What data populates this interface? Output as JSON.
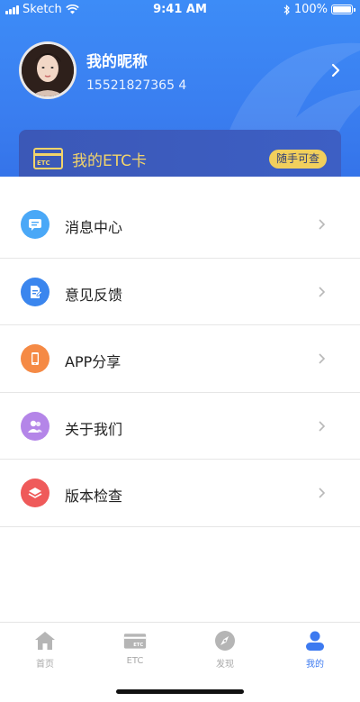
{
  "status_bar": {
    "carrier": "Sketch",
    "time": "9:41 AM",
    "battery": "100%",
    "battery_level": 1.0
  },
  "profile": {
    "nickname": "我的昵称",
    "phone": "15521827365 4"
  },
  "etc_card": {
    "icon_text": "ETC",
    "title": "我的ETC卡",
    "button_label": "随手可查"
  },
  "menu": [
    {
      "label": "消息中心",
      "icon": "message-icon",
      "color": "#4aa8f7"
    },
    {
      "label": "意见反馈",
      "icon": "feedback-icon",
      "color": "#3b86ee"
    },
    {
      "label": "APP分享",
      "icon": "phone-share-icon",
      "color": "#f58a45"
    },
    {
      "label": "关于我们",
      "icon": "users-icon",
      "color": "#b485e8"
    },
    {
      "label": "版本检查",
      "icon": "layers-icon",
      "color": "#ef5a5a"
    }
  ],
  "tabbar": [
    {
      "label": "首页",
      "icon": "home-icon",
      "active": false
    },
    {
      "label": "ETC",
      "icon": "etc-card-icon",
      "active": false
    },
    {
      "label": "发现",
      "icon": "compass-icon",
      "active": false
    },
    {
      "label": "我的",
      "icon": "profile-icon",
      "active": true
    }
  ],
  "colors": {
    "primary": "#3d7af0",
    "accent_gold": "#f3d46a",
    "inactive": "#a9a9a9"
  }
}
